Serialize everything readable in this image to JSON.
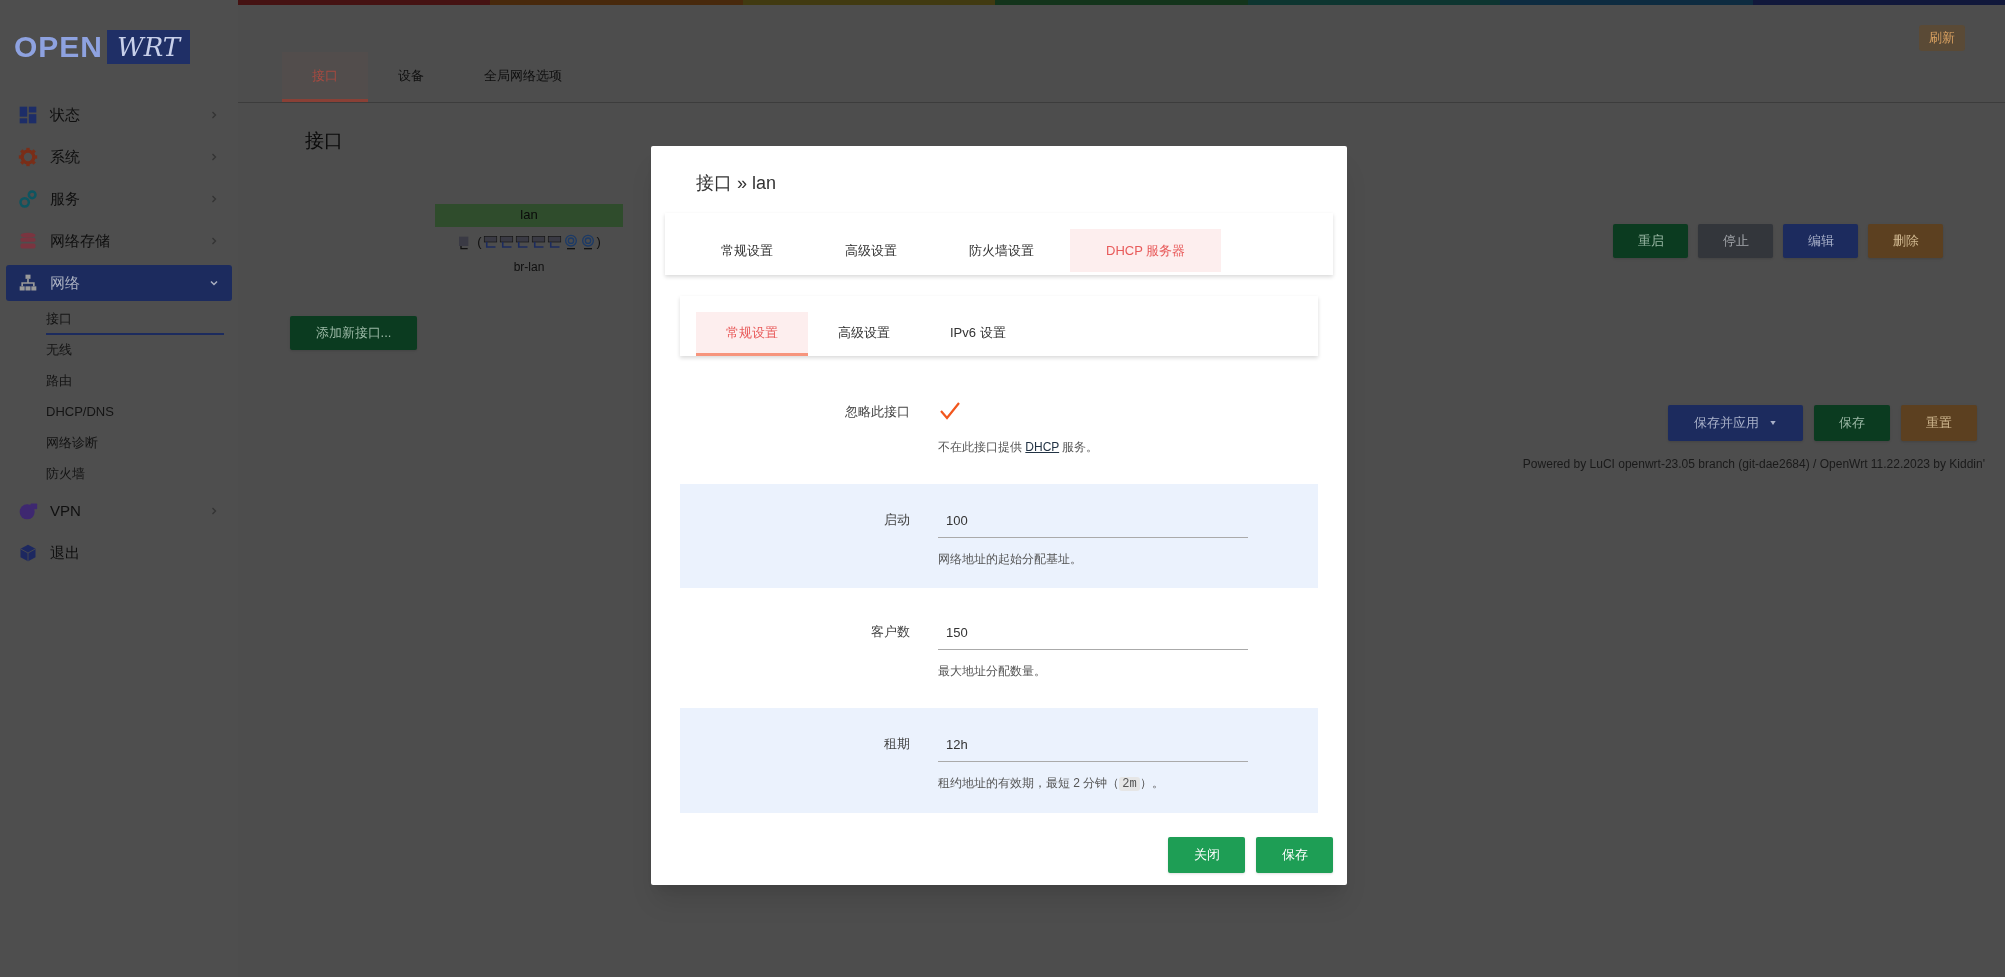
{
  "logo": {
    "open": "OPEN",
    "wrt": "WRT"
  },
  "sidebar": {
    "items": [
      {
        "kind": "group",
        "label": "状态",
        "expanded": false,
        "selected": false
      },
      {
        "kind": "group",
        "label": "系统",
        "expanded": false,
        "selected": false
      },
      {
        "kind": "group",
        "label": "服务",
        "expanded": false,
        "selected": false
      },
      {
        "kind": "group",
        "label": "网络存储",
        "expanded": false,
        "selected": false
      },
      {
        "kind": "group",
        "label": "网络",
        "expanded": true,
        "selected": true,
        "children": [
          {
            "label": "接口",
            "selected": true
          },
          {
            "label": "无线",
            "selected": false
          },
          {
            "label": "路由",
            "selected": false
          },
          {
            "label": "DHCP/DNS",
            "selected": false
          },
          {
            "label": "网络诊断",
            "selected": false
          },
          {
            "label": "防火墙",
            "selected": false
          }
        ]
      },
      {
        "kind": "group",
        "label": "VPN",
        "expanded": false,
        "selected": false
      },
      {
        "kind": "link",
        "label": "退出",
        "selected": false
      }
    ]
  },
  "refresh_button": "刷新",
  "tabs": [
    {
      "label": "接口",
      "selected": true
    },
    {
      "label": "设备",
      "selected": false
    },
    {
      "label": "全局网络选项",
      "selected": false
    }
  ],
  "page_title": "接口",
  "interface": {
    "name": "lan",
    "open_paren": "(",
    "close_paren": ")",
    "device": "br-lan",
    "actions": [
      {
        "label": "重启",
        "kind": "restart"
      },
      {
        "label": "停止",
        "kind": "stop"
      },
      {
        "label": "编辑",
        "kind": "edit"
      },
      {
        "label": "删除",
        "kind": "delete"
      }
    ]
  },
  "add_button": "添加新接口...",
  "footer_actions": [
    {
      "label": "保存并应用",
      "kind": "apply",
      "dropdown": true
    },
    {
      "label": "保存",
      "kind": "save",
      "dropdown": false
    },
    {
      "label": "重置",
      "kind": "reset",
      "dropdown": false
    }
  ],
  "footer": "Powered by LuCI openwrt-23.05 branch (git-dae2684) / OpenWrt 11.22.2023 by Kiddin'",
  "modal": {
    "title": "接口 » lan",
    "tabs": [
      {
        "label": "常规设置",
        "selected": false
      },
      {
        "label": "高级设置",
        "selected": false
      },
      {
        "label": "防火墙设置",
        "selected": false
      },
      {
        "label": "DHCP 服务器",
        "selected": true
      }
    ],
    "subtabs": [
      {
        "label": "常规设置",
        "selected": true
      },
      {
        "label": "高级设置",
        "selected": false
      },
      {
        "label": "IPv6 设置",
        "selected": false
      }
    ],
    "fields": [
      {
        "kind": "checkbox",
        "label": "忽略此接口",
        "checked": true,
        "description": [
          {
            "kind": "text",
            "text": "不在此接口提供 "
          },
          {
            "kind": "link",
            "text": "DHCP"
          },
          {
            "kind": "text",
            "text": " 服务。"
          }
        ]
      },
      {
        "kind": "text",
        "label": "启动",
        "value": "100",
        "description": [
          {
            "kind": "text",
            "text": "网络地址的起始分配基址。"
          }
        ]
      },
      {
        "kind": "text",
        "label": "客户数",
        "value": "150",
        "description": [
          {
            "kind": "text",
            "text": "最大地址分配数量。"
          }
        ]
      },
      {
        "kind": "text",
        "label": "租期",
        "value": "12h",
        "description": [
          {
            "kind": "text",
            "text": "租约地址的有效期，最短 2 分钟（"
          },
          {
            "kind": "code",
            "text": "2m"
          },
          {
            "kind": "text",
            "text": "）。"
          }
        ]
      }
    ],
    "buttons": [
      "关闭",
      "保存"
    ]
  }
}
